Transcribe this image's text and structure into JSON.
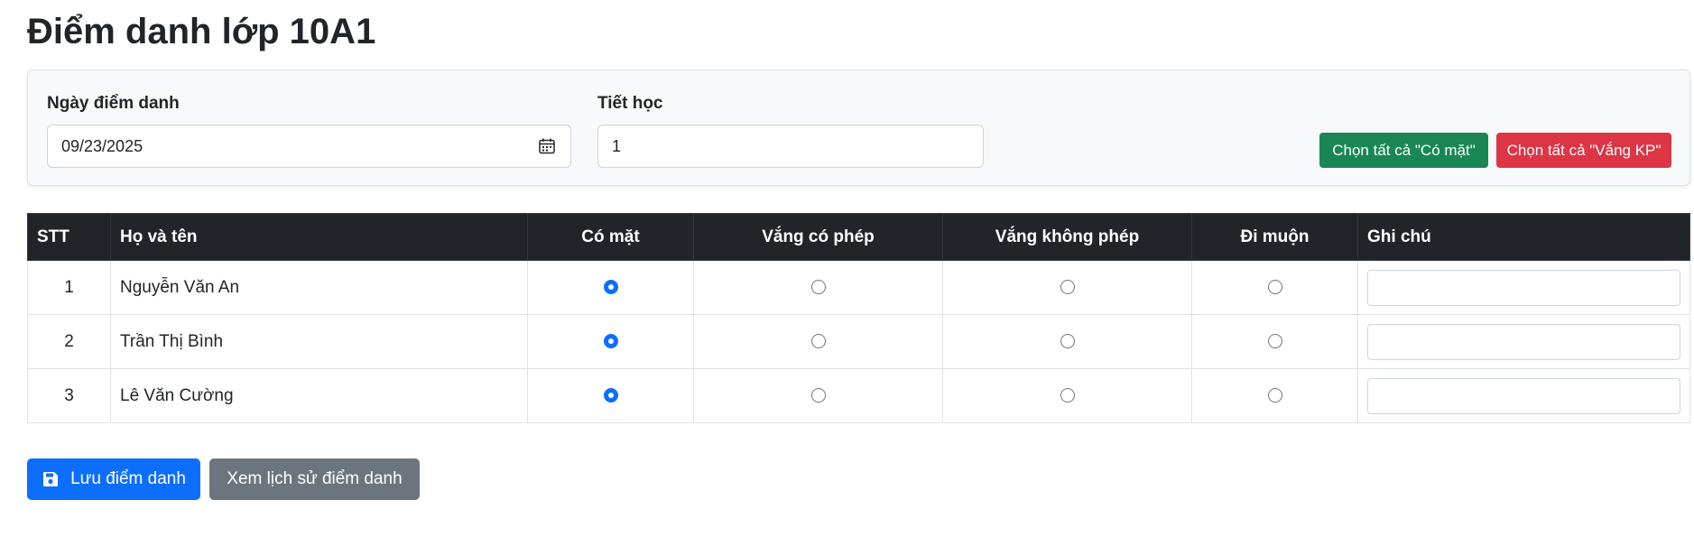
{
  "page": {
    "title": "Điểm danh lớp 10A1"
  },
  "filters": {
    "date_label": "Ngày điểm danh",
    "date_value": "09/23/2025",
    "period_label": "Tiết học",
    "period_value": "1",
    "select_all_present_label": "Chọn tất cả \"Có mặt\"",
    "select_all_absent_label": "Chọn tất cả \"Vắng KP\""
  },
  "table": {
    "headers": {
      "stt": "STT",
      "name": "Họ và tên",
      "present": "Có mặt",
      "excused": "Vắng có phép",
      "unexcused": "Vắng không phép",
      "late": "Đi muộn",
      "note": "Ghi chú"
    },
    "rows": [
      {
        "stt": "1",
        "name": "Nguyễn Văn An",
        "status": "present",
        "note": ""
      },
      {
        "stt": "2",
        "name": "Trần Thị Bình",
        "status": "present",
        "note": ""
      },
      {
        "stt": "3",
        "name": "Lê Văn Cường",
        "status": "present",
        "note": ""
      }
    ]
  },
  "actions": {
    "save_label": "Lưu điểm danh",
    "save_icon": "floppy-disk-icon",
    "history_label": "Xem lịch sử điểm danh"
  },
  "colors": {
    "primary": "#0d6efd",
    "success": "#198754",
    "danger": "#dc3545",
    "secondary": "#6c757d",
    "table_header": "#212529"
  }
}
